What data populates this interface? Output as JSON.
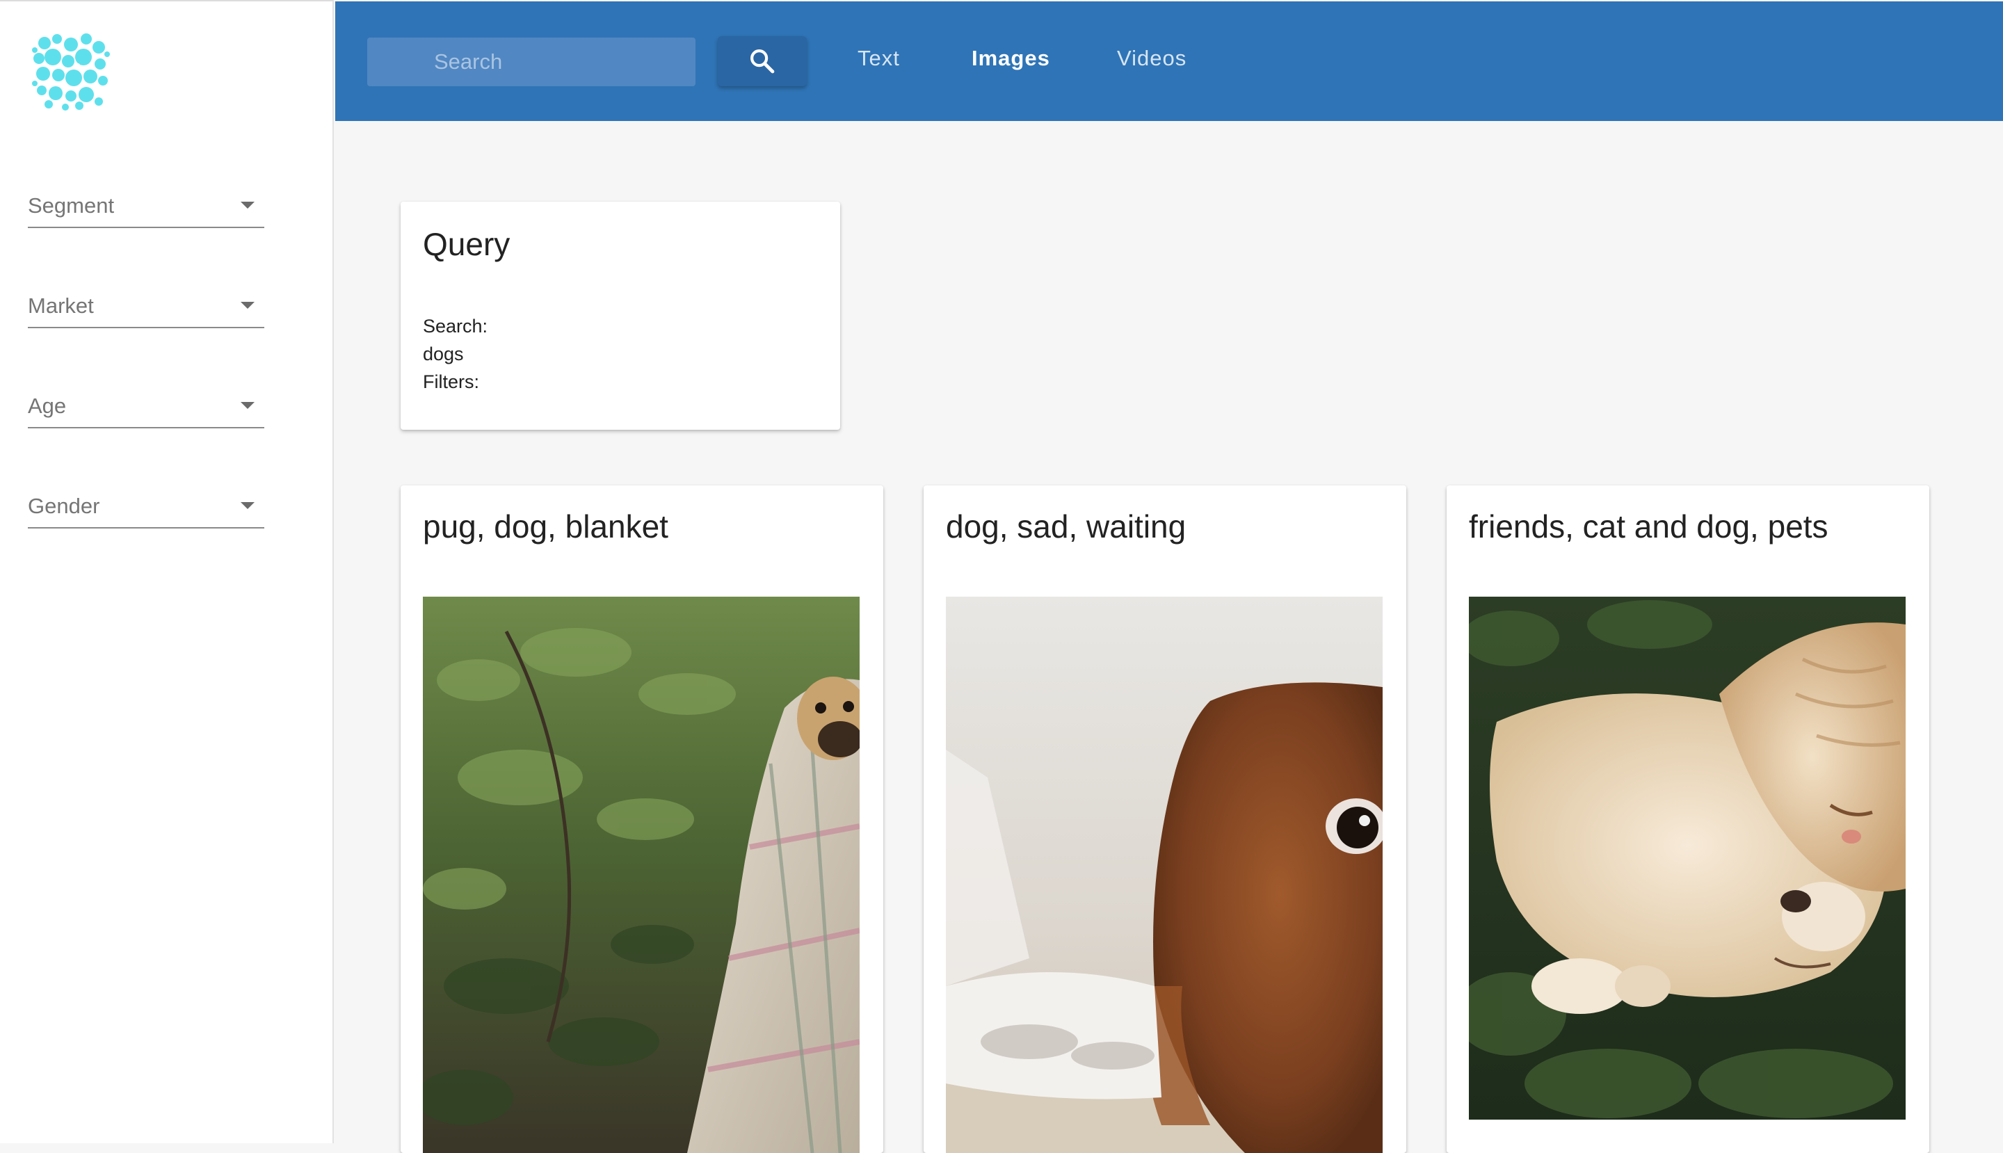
{
  "search": {
    "placeholder": "Search"
  },
  "nav": {
    "tabs": [
      "Text",
      "Images",
      "Videos"
    ],
    "active": "Images"
  },
  "filters": [
    {
      "label": "Segment"
    },
    {
      "label": "Market"
    },
    {
      "label": "Age"
    },
    {
      "label": "Gender"
    }
  ],
  "query": {
    "title": "Query",
    "search_label": "Search:",
    "search_value": "dogs",
    "filters_label": "Filters:"
  },
  "results": [
    {
      "title": "pug, dog, blanket"
    },
    {
      "title": "dog, sad, waiting"
    },
    {
      "title": "friends, cat and dog, pets"
    }
  ],
  "colors": {
    "topbar": "#2f74b6",
    "logo": "#5ee0ec",
    "background": "#f6f6f6"
  }
}
